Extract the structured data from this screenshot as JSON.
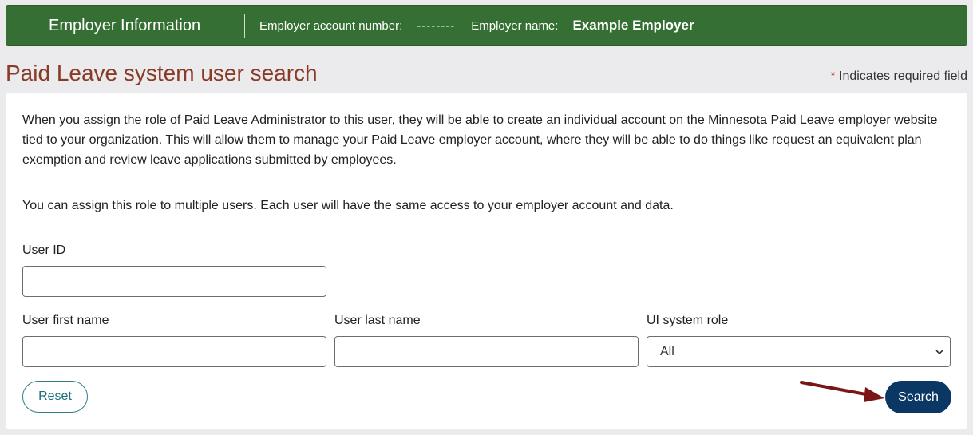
{
  "banner": {
    "title": "Employer Information",
    "account_label": "Employer account number:",
    "account_value": "--------",
    "name_label": "Employer name:",
    "name_value": "Example Employer"
  },
  "page": {
    "title": "Paid Leave system user search",
    "required_star": "*",
    "required_text": " Indicates required field"
  },
  "intro": {
    "paragraph1": "When you assign the role of Paid Leave Administrator to this user, they will be able to create an individual account on the Minnesota Paid Leave employer website tied to your organization. This will allow them to manage your Paid Leave employer account, where they will be able to do things like request an equivalent plan exemption and review leave applications submitted by employees.",
    "paragraph2": "You can assign this role to multiple users. Each user will have the same access to your employer account and data."
  },
  "form": {
    "user_id_label": "User ID",
    "user_id_value": "",
    "first_name_label": "User first name",
    "first_name_value": "",
    "last_name_label": "User last name",
    "last_name_value": "",
    "role_label": "UI system role",
    "role_selected": "All",
    "reset_label": "Reset",
    "search_label": "Search"
  },
  "colors": {
    "banner": "#356f33",
    "title": "#8a3b28",
    "primary_button": "#0b3765",
    "arrow": "#7a1515"
  },
  "icons": {
    "select": "chevron-down-icon",
    "annotation": "arrow-right-icon"
  }
}
